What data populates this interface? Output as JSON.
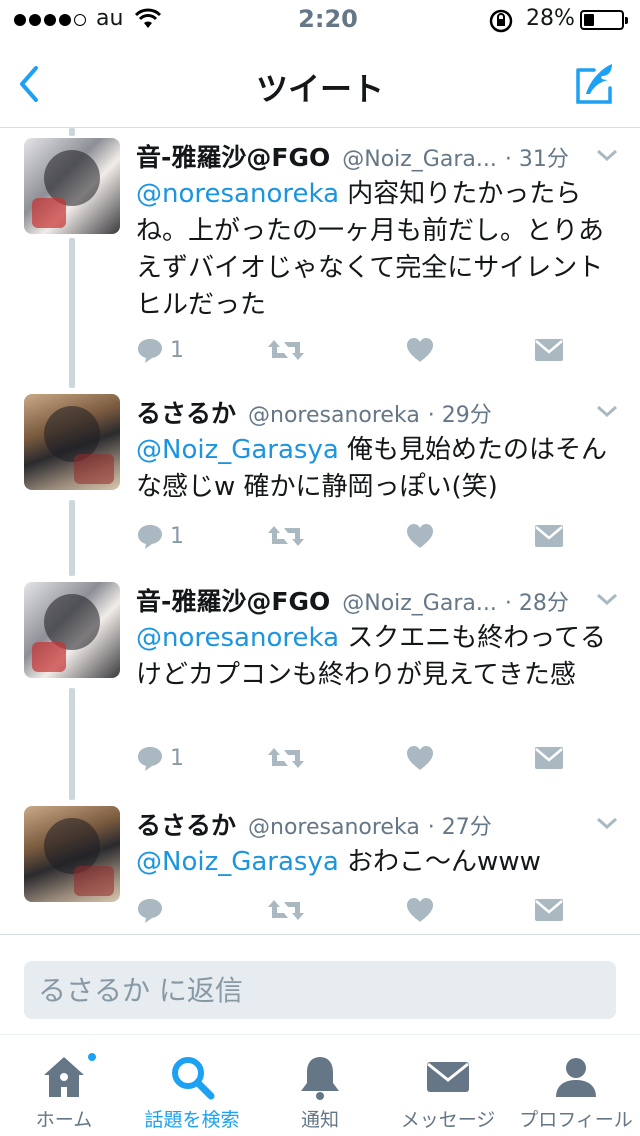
{
  "status_bar": {
    "carrier": "au",
    "time": "2:20",
    "battery": "28%",
    "battery_level": 0.28
  },
  "nav": {
    "title": "ツイート"
  },
  "tweets": [
    {
      "name": "音-雅羅沙@FGO",
      "handle": "@Noiz_Gara...",
      "time": "· 31分",
      "mention": "@noresanoreka",
      "text": " 内容知りたかったらね。上がったの一ヶ月も前だし。とりあえずバイオじゃなくて完全にサイレントヒルだった",
      "reply_count": "1"
    },
    {
      "name": "るさるか",
      "handle": "@noresanoreka",
      "time": "· 29分",
      "mention": "@Noiz_Garasya",
      "text": " 俺も見始めたのはそんな感じw 確かに静岡っぽい(笑)",
      "reply_count": "1"
    },
    {
      "name": "音-雅羅沙@FGO",
      "handle": "@Noiz_Gara...",
      "time": "· 28分",
      "mention": "@noresanoreka",
      "text": " スクエニも終わってるけどカプコンも終わりが見えてきた感",
      "reply_count": "1"
    },
    {
      "name": "るさるか",
      "handle": "@noresanoreka",
      "time": "· 27分",
      "mention": "@Noiz_Garasya",
      "text": " おわこ〜んwww",
      "reply_count": ""
    }
  ],
  "reply": {
    "placeholder": "るさるか に返信"
  },
  "tabs": [
    {
      "label": "ホーム",
      "icon": "home-icon",
      "active": false,
      "badge": true
    },
    {
      "label": "話題を検索",
      "icon": "search-icon",
      "active": true,
      "badge": false
    },
    {
      "label": "通知",
      "icon": "bell-icon",
      "active": false,
      "badge": false
    },
    {
      "label": "メッセージ",
      "icon": "envelope-icon",
      "active": false,
      "badge": false
    },
    {
      "label": "プロフィール",
      "icon": "person-icon",
      "active": false,
      "badge": false
    }
  ],
  "colors": {
    "accent": "#1da1f2",
    "mention": "#1b95e0",
    "icon_gray": "#aab8c2",
    "thread_line": "#ccd6dd"
  }
}
